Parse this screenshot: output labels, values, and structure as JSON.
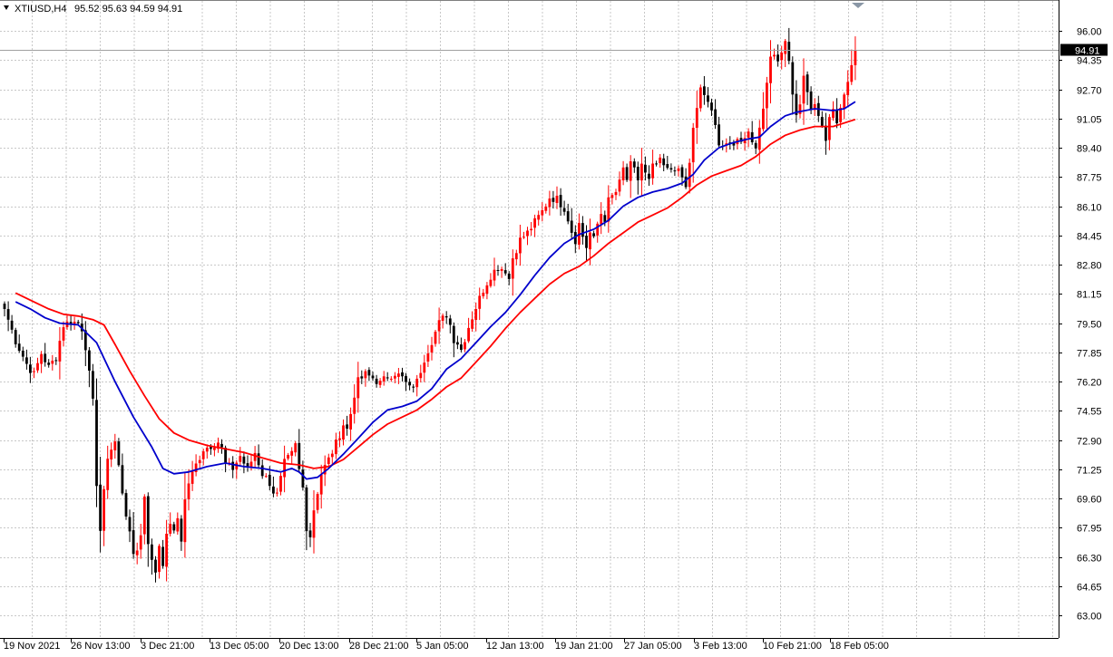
{
  "header": {
    "symbol": "XTIUSD,H4",
    "ohlc": "95.52 95.63 94.59 94.91"
  },
  "price_badge": "94.91",
  "chart_data": {
    "type": "candlestick",
    "grid": true,
    "ylim": [
      63.0,
      96.6
    ],
    "y_ticks": [
      "96.00",
      "94.35",
      "92.70",
      "91.05",
      "89.40",
      "87.75",
      "86.10",
      "84.45",
      "82.80",
      "81.15",
      "79.50",
      "77.85",
      "76.20",
      "74.55",
      "72.90",
      "71.25",
      "69.60",
      "67.95",
      "66.30",
      "64.65",
      "63.00"
    ],
    "x_ticks": [
      "19 Nov 2021",
      "26 Nov 13:00",
      "3 Dec 21:00",
      "13 Dec 05:00",
      "20 Dec 13:00",
      "28 Dec 21:00",
      "5 Jan 05:00",
      "12 Jan 13:00",
      "19 Jan 21:00",
      "27 Jan 05:00",
      "3 Feb 13:00",
      "10 Feb 21:00",
      "18 Feb 05:00"
    ],
    "last_price": 94.91,
    "colors": {
      "up": "#ff0000",
      "down": "#000000",
      "ma_fast": "#0000cc",
      "ma_slow": "#ff0000",
      "grid": "#c8c8c8"
    },
    "close_path": [
      [
        0,
        80.3
      ],
      [
        3,
        78.5
      ],
      [
        6,
        77.2
      ],
      [
        8,
        76.6
      ],
      [
        10,
        77.8
      ],
      [
        12,
        77.0
      ],
      [
        14,
        77.6
      ],
      [
        16,
        79.4
      ],
      [
        18,
        79.6
      ],
      [
        20,
        79.5
      ],
      [
        21,
        79.2
      ],
      [
        22,
        78.2
      ],
      [
        24,
        75.0
      ],
      [
        25,
        70.5
      ],
      [
        26,
        67.8
      ],
      [
        28,
        72.0
      ],
      [
        30,
        72.8
      ],
      [
        32,
        70.0
      ],
      [
        34,
        67.5
      ],
      [
        35,
        66.5
      ],
      [
        36,
        66.8
      ],
      [
        37,
        67.5
      ],
      [
        38,
        69.8
      ],
      [
        39,
        67.2
      ],
      [
        40,
        66.0
      ],
      [
        41,
        65.5
      ],
      [
        42,
        67.0
      ],
      [
        43,
        66.0
      ],
      [
        44,
        67.4
      ],
      [
        45,
        68.3
      ],
      [
        46,
        67.6
      ],
      [
        47,
        68.5
      ],
      [
        48,
        67.3
      ],
      [
        49,
        69.5
      ],
      [
        50,
        70.5
      ],
      [
        52,
        71.5
      ],
      [
        54,
        72.4
      ],
      [
        56,
        72.6
      ],
      [
        58,
        72.8
      ],
      [
        59,
        72.4
      ],
      [
        60,
        71.5
      ],
      [
        62,
        71.3
      ],
      [
        64,
        72.0
      ],
      [
        66,
        71.2
      ],
      [
        68,
        72.2
      ],
      [
        70,
        71.0
      ],
      [
        72,
        70.5
      ],
      [
        73,
        70.0
      ],
      [
        74,
        69.8
      ],
      [
        76,
        71.6
      ],
      [
        78,
        72.1
      ],
      [
        79,
        72.6
      ],
      [
        80,
        71.2
      ],
      [
        81,
        70.2
      ],
      [
        82,
        68.0
      ],
      [
        83,
        67.5
      ],
      [
        84,
        69.0
      ],
      [
        85,
        70.0
      ],
      [
        86,
        71.0
      ],
      [
        88,
        71.8
      ],
      [
        90,
        72.7
      ],
      [
        92,
        73.8
      ],
      [
        93,
        73.5
      ],
      [
        94,
        74.4
      ],
      [
        95,
        75.5
      ],
      [
        96,
        76.2
      ],
      [
        98,
        76.6
      ],
      [
        100,
        76.4
      ],
      [
        102,
        76.1
      ],
      [
        104,
        76.5
      ],
      [
        106,
        76.7
      ],
      [
        108,
        76.4
      ],
      [
        110,
        75.8
      ],
      [
        112,
        76.2
      ],
      [
        114,
        77.5
      ],
      [
        116,
        78.5
      ],
      [
        118,
        79.5
      ],
      [
        120,
        80.0
      ],
      [
        121,
        79.4
      ],
      [
        122,
        78.6
      ],
      [
        123,
        78.4
      ],
      [
        124,
        78.0
      ],
      [
        126,
        79.3
      ],
      [
        128,
        80.4
      ],
      [
        130,
        81.4
      ],
      [
        132,
        82.2
      ],
      [
        134,
        82.7
      ],
      [
        136,
        82.5
      ],
      [
        137,
        82.0
      ],
      [
        138,
        83.2
      ],
      [
        140,
        84.2
      ],
      [
        142,
        84.6
      ],
      [
        144,
        85.2
      ],
      [
        146,
        85.8
      ],
      [
        148,
        86.6
      ],
      [
        150,
        86.5
      ],
      [
        152,
        86.0
      ],
      [
        153,
        85.4
      ],
      [
        154,
        84.7
      ],
      [
        155,
        84.2
      ],
      [
        156,
        85.1
      ],
      [
        157,
        84.4
      ],
      [
        158,
        83.8
      ],
      [
        159,
        84.6
      ],
      [
        160,
        84.2
      ],
      [
        161,
        85.1
      ],
      [
        162,
        85.7
      ],
      [
        163,
        85.4
      ],
      [
        164,
        86.4
      ],
      [
        166,
        86.9
      ],
      [
        167,
        87.4
      ],
      [
        168,
        88.2
      ],
      [
        169,
        87.6
      ],
      [
        170,
        88.4
      ],
      [
        171,
        88.1
      ],
      [
        172,
        87.6
      ],
      [
        173,
        88.5
      ],
      [
        174,
        87.9
      ],
      [
        175,
        87.5
      ],
      [
        176,
        88.3
      ],
      [
        178,
        88.6
      ],
      [
        180,
        88.1
      ],
      [
        182,
        88.3
      ],
      [
        184,
        87.7
      ],
      [
        185,
        87.1
      ],
      [
        186,
        88.6
      ],
      [
        187,
        90.4
      ],
      [
        188,
        91.5
      ],
      [
        189,
        92.8
      ],
      [
        190,
        92.4
      ],
      [
        191,
        91.8
      ],
      [
        192,
        91.4
      ],
      [
        193,
        90.9
      ],
      [
        194,
        89.6
      ],
      [
        196,
        89.4
      ],
      [
        198,
        89.7
      ],
      [
        200,
        89.9
      ],
      [
        202,
        90.3
      ],
      [
        203,
        89.8
      ],
      [
        204,
        89.6
      ],
      [
        205,
        90.3
      ],
      [
        206,
        91.6
      ],
      [
        207,
        93.3
      ],
      [
        208,
        94.6
      ],
      [
        209,
        94.8
      ],
      [
        210,
        94.2
      ],
      [
        211,
        94.9
      ],
      [
        212,
        95.3
      ],
      [
        213,
        94.4
      ],
      [
        214,
        92.2
      ],
      [
        215,
        91.2
      ],
      [
        216,
        91.9
      ],
      [
        217,
        93.3
      ],
      [
        218,
        92.7
      ],
      [
        219,
        91.6
      ],
      [
        220,
        91.9
      ],
      [
        221,
        91.0
      ],
      [
        222,
        90.6
      ],
      [
        223,
        90.0
      ],
      [
        224,
        91.3
      ],
      [
        225,
        91.6
      ],
      [
        226,
        90.9
      ],
      [
        227,
        91.7
      ],
      [
        228,
        92.4
      ],
      [
        229,
        93.2
      ],
      [
        230,
        94.3
      ],
      [
        231,
        94.91
      ]
    ],
    "ma_fast": [
      [
        3,
        80.7
      ],
      [
        7,
        80.3
      ],
      [
        11,
        79.8
      ],
      [
        15,
        79.5
      ],
      [
        20,
        79.4
      ],
      [
        25,
        78.4
      ],
      [
        30,
        76.2
      ],
      [
        35,
        74.2
      ],
      [
        40,
        72.5
      ],
      [
        43,
        71.3
      ],
      [
        46,
        71.0
      ],
      [
        50,
        71.1
      ],
      [
        55,
        71.4
      ],
      [
        60,
        71.6
      ],
      [
        65,
        71.4
      ],
      [
        70,
        71.3
      ],
      [
        75,
        71.1
      ],
      [
        78,
        71.3
      ],
      [
        80,
        71.1
      ],
      [
        82,
        70.7
      ],
      [
        85,
        70.8
      ],
      [
        88,
        71.3
      ],
      [
        92,
        72.1
      ],
      [
        96,
        73.0
      ],
      [
        100,
        73.9
      ],
      [
        104,
        74.6
      ],
      [
        108,
        74.8
      ],
      [
        112,
        75.1
      ],
      [
        116,
        75.8
      ],
      [
        120,
        76.9
      ],
      [
        124,
        77.5
      ],
      [
        128,
        78.4
      ],
      [
        132,
        79.3
      ],
      [
        136,
        80.1
      ],
      [
        140,
        81.1
      ],
      [
        144,
        82.2
      ],
      [
        148,
        83.2
      ],
      [
        152,
        84.0
      ],
      [
        156,
        84.5
      ],
      [
        160,
        84.8
      ],
      [
        164,
        85.3
      ],
      [
        168,
        86.1
      ],
      [
        172,
        86.6
      ],
      [
        176,
        86.9
      ],
      [
        180,
        87.1
      ],
      [
        184,
        87.4
      ],
      [
        187,
        87.9
      ],
      [
        190,
        88.7
      ],
      [
        194,
        89.4
      ],
      [
        198,
        89.7
      ],
      [
        202,
        89.9
      ],
      [
        205,
        90.0
      ],
      [
        208,
        90.6
      ],
      [
        212,
        91.2
      ],
      [
        215,
        91.4
      ],
      [
        220,
        91.6
      ],
      [
        225,
        91.5
      ],
      [
        228,
        91.6
      ],
      [
        231,
        92.0
      ]
    ],
    "ma_slow": [
      [
        3,
        81.2
      ],
      [
        7,
        80.8
      ],
      [
        12,
        80.3
      ],
      [
        16,
        80.0
      ],
      [
        20,
        79.9
      ],
      [
        24,
        79.7
      ],
      [
        27,
        79.4
      ],
      [
        30,
        78.3
      ],
      [
        34,
        76.8
      ],
      [
        38,
        75.4
      ],
      [
        42,
        74.1
      ],
      [
        46,
        73.3
      ],
      [
        50,
        72.9
      ],
      [
        55,
        72.6
      ],
      [
        60,
        72.4
      ],
      [
        65,
        72.2
      ],
      [
        70,
        71.9
      ],
      [
        75,
        71.6
      ],
      [
        80,
        71.5
      ],
      [
        84,
        71.3
      ],
      [
        88,
        71.4
      ],
      [
        92,
        71.8
      ],
      [
        96,
        72.5
      ],
      [
        100,
        73.2
      ],
      [
        104,
        73.8
      ],
      [
        108,
        74.2
      ],
      [
        112,
        74.6
      ],
      [
        116,
        75.2
      ],
      [
        120,
        75.9
      ],
      [
        124,
        76.4
      ],
      [
        128,
        77.3
      ],
      [
        132,
        78.2
      ],
      [
        136,
        79.2
      ],
      [
        140,
        80.1
      ],
      [
        144,
        80.9
      ],
      [
        148,
        81.7
      ],
      [
        152,
        82.3
      ],
      [
        156,
        82.7
      ],
      [
        160,
        83.3
      ],
      [
        164,
        84.0
      ],
      [
        168,
        84.6
      ],
      [
        172,
        85.2
      ],
      [
        176,
        85.6
      ],
      [
        180,
        86.0
      ],
      [
        184,
        86.6
      ],
      [
        188,
        87.3
      ],
      [
        192,
        87.8
      ],
      [
        196,
        88.1
      ],
      [
        200,
        88.4
      ],
      [
        204,
        88.9
      ],
      [
        208,
        89.6
      ],
      [
        212,
        90.1
      ],
      [
        216,
        90.4
      ],
      [
        220,
        90.6
      ],
      [
        225,
        90.6
      ],
      [
        231,
        91.0
      ]
    ]
  }
}
